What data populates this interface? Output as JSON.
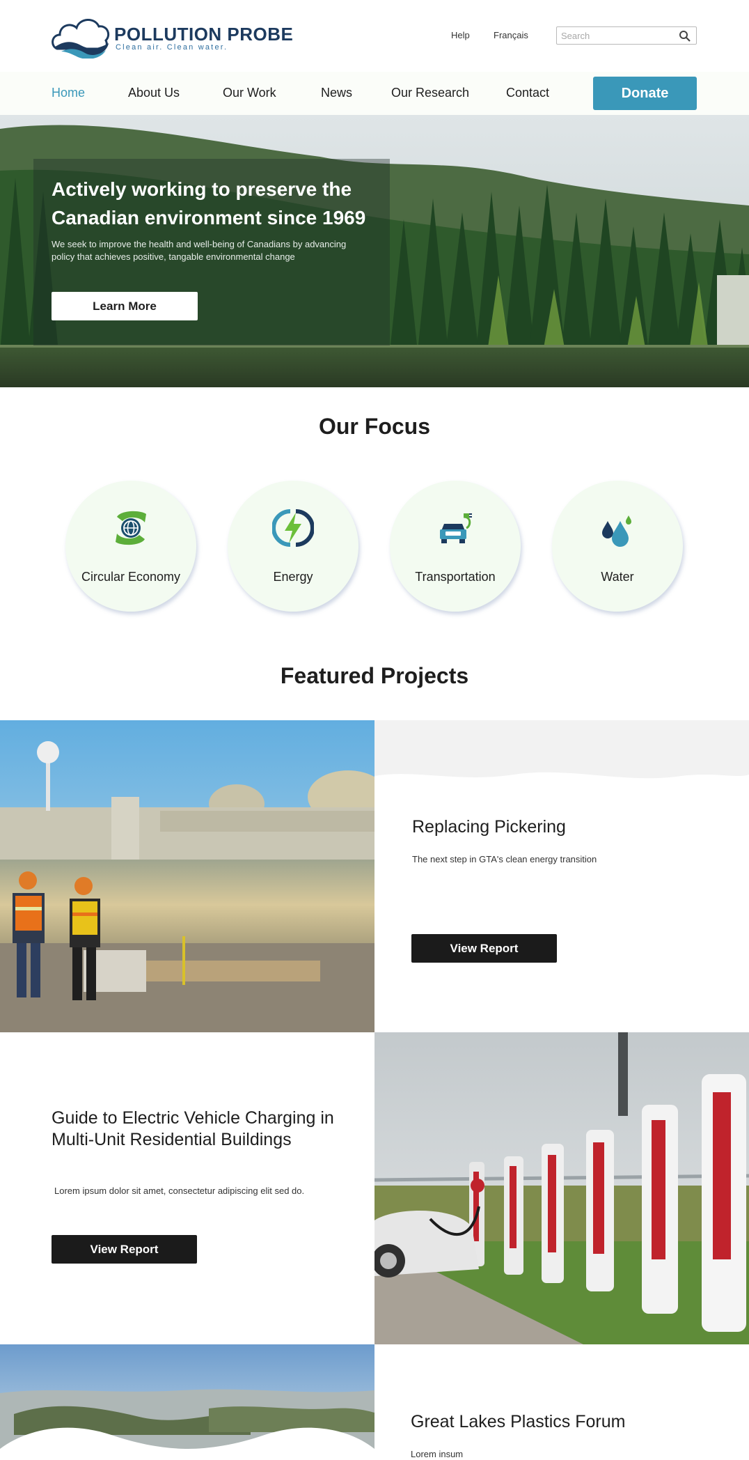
{
  "brand": {
    "name": "POLLUTION PROBE",
    "tagline": "Clean air. Clean water.",
    "primary_color": "#3a98b9",
    "dark_color": "#1c3a5e"
  },
  "utility_nav": {
    "help": "Help",
    "language": "Français",
    "search_placeholder": "Search",
    "search_value": ""
  },
  "nav": {
    "items": [
      {
        "label": "Home",
        "active": true
      },
      {
        "label": "About Us"
      },
      {
        "label": "Our Work"
      },
      {
        "label": "News"
      },
      {
        "label": "Our Research"
      },
      {
        "label": "Contact"
      }
    ],
    "donate_label": "Donate"
  },
  "hero": {
    "title": "Actively working to preserve the Canadian environment since 1969",
    "subtitle": "We seek to improve the health and well-being of Canadians by advancing policy that achieves positive, tangable environmental change",
    "button_label": "Learn More"
  },
  "focus": {
    "title": "Our Focus",
    "items": [
      {
        "label": "Circular Economy",
        "icon": "recycle-globe-icon"
      },
      {
        "label": "Energy",
        "icon": "lightning-bolt-icon"
      },
      {
        "label": "Transportation",
        "icon": "electric-car-icon"
      },
      {
        "label": "Water",
        "icon": "water-drops-icon"
      }
    ]
  },
  "featured": {
    "title": "Featured Projects",
    "projects": [
      {
        "title": "Replacing Pickering",
        "description": "The next step in GTA's clean energy transition",
        "button_label": "View Report",
        "image": "nuclear-plant-workers-photo"
      },
      {
        "title": "Guide to Electric Vehicle Charging in Multi-Unit Residential Buildings",
        "description": "Lorem ipsum dolor sit amet, consectetur adipiscing elit sed do.",
        "button_label": "View Report",
        "image": "ev-charging-stations-photo"
      },
      {
        "title": "Great Lakes Plastics Forum",
        "description": "Lorem insum",
        "image": "great-lakes-aerial-photo"
      }
    ]
  }
}
